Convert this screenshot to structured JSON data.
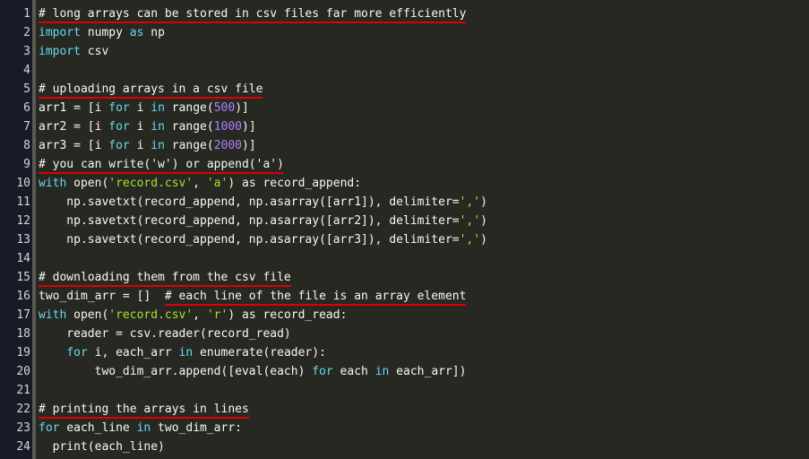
{
  "editor": {
    "language": "python",
    "colors": {
      "background": "#272822",
      "gutter": "#161b27",
      "keyword": "#66d9ef",
      "string": "#a6e22e",
      "number": "#ae81ff",
      "text": "#f8f8f2",
      "comment_underline": "#e00000"
    },
    "lines": [
      {
        "n": "1",
        "tokens": [
          {
            "t": "cm",
            "v": "# long arrays can be stored in csv files far more efficiently"
          }
        ]
      },
      {
        "n": "2",
        "tokens": [
          {
            "t": "kw",
            "v": "import"
          },
          {
            "t": "plain",
            "v": " numpy "
          },
          {
            "t": "kw",
            "v": "as"
          },
          {
            "t": "plain",
            "v": " np"
          }
        ]
      },
      {
        "n": "3",
        "tokens": [
          {
            "t": "kw",
            "v": "import"
          },
          {
            "t": "plain",
            "v": " csv"
          }
        ]
      },
      {
        "n": "4",
        "tokens": []
      },
      {
        "n": "5",
        "tokens": [
          {
            "t": "cm",
            "v": "# uploading arrays in a csv file"
          }
        ]
      },
      {
        "n": "6",
        "tokens": [
          {
            "t": "plain",
            "v": "arr1 = [i "
          },
          {
            "t": "kw",
            "v": "for"
          },
          {
            "t": "plain",
            "v": " i "
          },
          {
            "t": "kw",
            "v": "in"
          },
          {
            "t": "plain",
            "v": " range("
          },
          {
            "t": "num",
            "v": "500"
          },
          {
            "t": "plain",
            "v": ")]"
          }
        ]
      },
      {
        "n": "7",
        "tokens": [
          {
            "t": "plain",
            "v": "arr2 = [i "
          },
          {
            "t": "kw",
            "v": "for"
          },
          {
            "t": "plain",
            "v": " i "
          },
          {
            "t": "kw",
            "v": "in"
          },
          {
            "t": "plain",
            "v": " range("
          },
          {
            "t": "num",
            "v": "1000"
          },
          {
            "t": "plain",
            "v": ")]"
          }
        ]
      },
      {
        "n": "8",
        "tokens": [
          {
            "t": "plain",
            "v": "arr3 = [i "
          },
          {
            "t": "kw",
            "v": "for"
          },
          {
            "t": "plain",
            "v": " i "
          },
          {
            "t": "kw",
            "v": "in"
          },
          {
            "t": "plain",
            "v": " range("
          },
          {
            "t": "num",
            "v": "2000"
          },
          {
            "t": "plain",
            "v": ")]"
          }
        ]
      },
      {
        "n": "9",
        "tokens": [
          {
            "t": "cm",
            "v": "# you can write('w') or append('a')"
          }
        ]
      },
      {
        "n": "10",
        "tokens": [
          {
            "t": "kw",
            "v": "with"
          },
          {
            "t": "plain",
            "v": " open("
          },
          {
            "t": "str",
            "v": "'record.csv'"
          },
          {
            "t": "plain",
            "v": ", "
          },
          {
            "t": "str",
            "v": "'a'"
          },
          {
            "t": "plain",
            "v": ") as record_append:"
          }
        ]
      },
      {
        "n": "11",
        "tokens": [
          {
            "t": "plain",
            "v": "    np.savetxt(record_append, np.asarray([arr1]), delimiter="
          },
          {
            "t": "str",
            "v": "','"
          },
          {
            "t": "plain",
            "v": ")"
          }
        ]
      },
      {
        "n": "12",
        "tokens": [
          {
            "t": "plain",
            "v": "    np.savetxt(record_append, np.asarray([arr2]), delimiter="
          },
          {
            "t": "str",
            "v": "','"
          },
          {
            "t": "plain",
            "v": ")"
          }
        ]
      },
      {
        "n": "13",
        "tokens": [
          {
            "t": "plain",
            "v": "    np.savetxt(record_append, np.asarray([arr3]), delimiter="
          },
          {
            "t": "str",
            "v": "','"
          },
          {
            "t": "plain",
            "v": ")"
          }
        ]
      },
      {
        "n": "14",
        "tokens": []
      },
      {
        "n": "15",
        "tokens": [
          {
            "t": "cm",
            "v": "# downloading them from the csv file"
          }
        ]
      },
      {
        "n": "16",
        "tokens": [
          {
            "t": "plain",
            "v": "two_dim_arr = []  "
          },
          {
            "t": "cm",
            "v": "# each line of the file is an array element"
          }
        ]
      },
      {
        "n": "17",
        "tokens": [
          {
            "t": "kw",
            "v": "with"
          },
          {
            "t": "plain",
            "v": " open("
          },
          {
            "t": "str",
            "v": "'record.csv'"
          },
          {
            "t": "plain",
            "v": ", "
          },
          {
            "t": "str",
            "v": "'r'"
          },
          {
            "t": "plain",
            "v": ") as record_read:"
          }
        ]
      },
      {
        "n": "18",
        "tokens": [
          {
            "t": "plain",
            "v": "    reader = csv.reader(record_read)"
          }
        ]
      },
      {
        "n": "19",
        "tokens": [
          {
            "t": "plain",
            "v": "    "
          },
          {
            "t": "kw",
            "v": "for"
          },
          {
            "t": "plain",
            "v": " i, each_arr "
          },
          {
            "t": "kw",
            "v": "in"
          },
          {
            "t": "plain",
            "v": " enumerate(reader):"
          }
        ]
      },
      {
        "n": "20",
        "tokens": [
          {
            "t": "plain",
            "v": "        two_dim_arr.append([eval(each) "
          },
          {
            "t": "kw",
            "v": "for"
          },
          {
            "t": "plain",
            "v": " each "
          },
          {
            "t": "kw",
            "v": "in"
          },
          {
            "t": "plain",
            "v": " each_arr])"
          }
        ]
      },
      {
        "n": "21",
        "tokens": []
      },
      {
        "n": "22",
        "tokens": [
          {
            "t": "cm",
            "v": "# printing the arrays in lines"
          }
        ]
      },
      {
        "n": "23",
        "tokens": [
          {
            "t": "kw",
            "v": "for"
          },
          {
            "t": "plain",
            "v": " each_line "
          },
          {
            "t": "kw",
            "v": "in"
          },
          {
            "t": "plain",
            "v": " two_dim_arr:"
          }
        ]
      },
      {
        "n": "24",
        "tokens": [
          {
            "t": "plain",
            "v": "  print(each_line)"
          }
        ]
      }
    ]
  }
}
